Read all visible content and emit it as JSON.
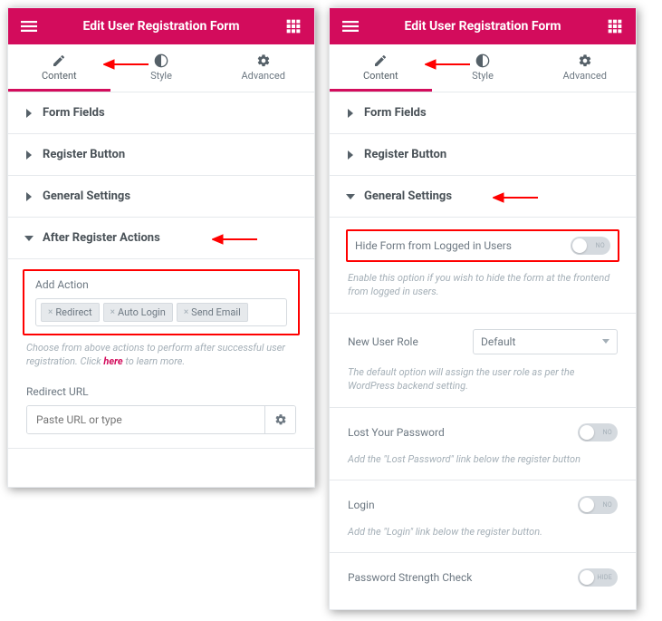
{
  "left": {
    "title": "Edit User Registration Form",
    "tabs": {
      "content": "Content",
      "style": "Style",
      "advanced": "Advanced",
      "active": "content"
    },
    "sections": {
      "formFields": "Form Fields",
      "registerBtn": "Register Button",
      "general": "General Settings",
      "afterReg": "After Register Actions"
    },
    "addAction": {
      "label": "Add Action",
      "pills": [
        "Redirect",
        "Auto Login",
        "Send Email"
      ],
      "help_pre": "Choose from above actions to perform after successful user registration. Click ",
      "help_link": "here",
      "help_post": " to learn more."
    },
    "redirect": {
      "label": "Redirect URL",
      "placeholder": "Paste URL or type"
    }
  },
  "right": {
    "title": "Edit User Registration Form",
    "tabs": {
      "content": "Content",
      "style": "Style",
      "advanced": "Advanced",
      "active": "content"
    },
    "sections": {
      "formFields": "Form Fields",
      "registerBtn": "Register Button",
      "general": "General Settings"
    },
    "hideForm": {
      "label": "Hide Form from Logged in Users",
      "state": "NO",
      "help": "Enable this option if you wish to hide the form at the frontend from logged in users."
    },
    "newRole": {
      "label": "New User Role",
      "value": "Default",
      "help": "The default option will assign the user role as per the WordPress backend setting."
    },
    "lostPwd": {
      "label": "Lost Your Password",
      "state": "NO",
      "help": "Add the \"Lost Password\" link below the register button"
    },
    "login": {
      "label": "Login",
      "state": "NO",
      "help": "Add the \"Login\" link below the register button."
    },
    "pwdCheck": {
      "label": "Password Strength Check",
      "state": "HIDE"
    }
  }
}
